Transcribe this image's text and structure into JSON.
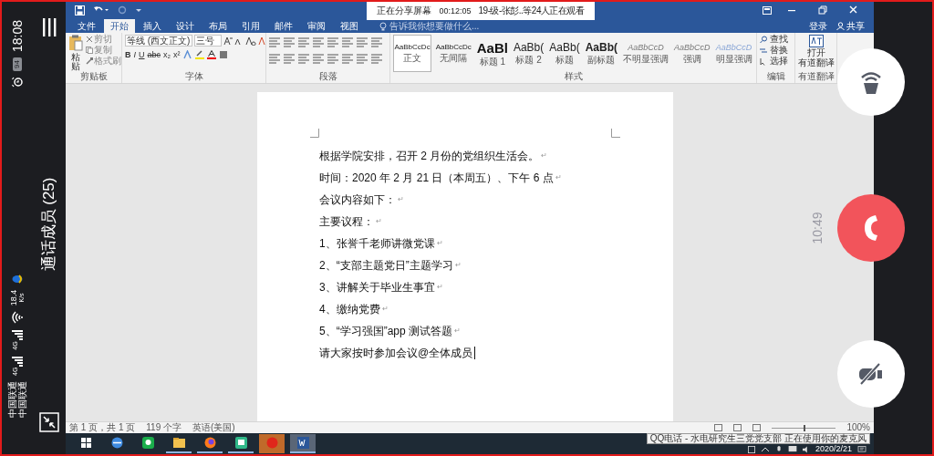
{
  "phone_status": {
    "carriers": [
      "中国联通",
      "中国联通"
    ],
    "signals": [
      {
        "network": "4G"
      },
      {
        "network": "4G"
      }
    ],
    "speed": "18.4",
    "speed_unit": "K/s",
    "battery": "94",
    "time": "18:08"
  },
  "call": {
    "title": "通话成员 (25)",
    "duration": "10:49",
    "buttons": [
      {
        "kind": "speaker"
      },
      {
        "kind": "hangup"
      },
      {
        "kind": "camera_off"
      }
    ]
  },
  "share_banner": {
    "status": "正在分享屏幕",
    "elapsed": "00:12:05",
    "viewers": "19-级-张彭..等24人正在观看"
  },
  "word": {
    "tabs": [
      {
        "label": "文件",
        "selected": false
      },
      {
        "label": "开始",
        "selected": true
      },
      {
        "label": "插入",
        "selected": false
      },
      {
        "label": "设计",
        "selected": false
      },
      {
        "label": "布局",
        "selected": false
      },
      {
        "label": "引用",
        "selected": false
      },
      {
        "label": "邮件",
        "selected": false
      },
      {
        "label": "审阅",
        "selected": false
      },
      {
        "label": "视图",
        "selected": false
      }
    ],
    "tell_me": {
      "placeholder": "告诉我你想要做什么..."
    },
    "account": {
      "sign_in": "登录",
      "share": "共享"
    },
    "clipboard": {
      "label": "剪贴板",
      "paste": "粘贴",
      "items": [
        "剪切",
        "复制",
        "格式刷"
      ]
    },
    "font": {
      "label": "字体",
      "font_name": "等线 (西文正文)",
      "font_size": "三号",
      "format_buttons": [
        "B",
        "I",
        "U",
        "abc",
        "x₂",
        "x²"
      ]
    },
    "paragraph": {
      "label": "段落"
    },
    "styles": {
      "label": "样式",
      "items": [
        {
          "kind": "body",
          "sample": "AaBbCcDc",
          "name": "正文",
          "selected": true
        },
        {
          "kind": "body",
          "sample": "AaBbCcDc",
          "name": "无间隔",
          "selected": false
        },
        {
          "kind": "heading1",
          "sample": "AaBl",
          "name": "标题 1",
          "selected": false
        },
        {
          "kind": "heading2",
          "sample": "AaBb(",
          "name": "标题 2",
          "selected": false
        },
        {
          "kind": "heading2",
          "sample": "AaBb(",
          "name": "标题",
          "selected": false
        },
        {
          "kind": "subtitle",
          "sample": "AaBb(",
          "name": "副标题",
          "selected": false
        },
        {
          "kind": "subtle",
          "sample": "AaBbCcD",
          "name": "不明显强调",
          "selected": false
        },
        {
          "kind": "subtle",
          "sample": "AaBbCcD",
          "name": "强调",
          "selected": false
        },
        {
          "kind": "intense",
          "sample": "AaBbCcD",
          "name": "明显强调",
          "selected": false
        }
      ]
    },
    "editing": {
      "label": "编辑",
      "items": [
        "查找",
        "替换",
        "选择"
      ]
    },
    "translate": {
      "label": "有道翻译",
      "button": [
        "打开",
        "有道翻译"
      ]
    },
    "document": {
      "lines": [
        {
          "text": "根据学院安排，召开 2 月份的党组织生活会。",
          "end": "↵"
        },
        {
          "text": "时间：2020 年 2 月 21 日（本周五）、下午 6 点",
          "end": "↵"
        },
        {
          "text": "会议内容如下：",
          "end": "↵"
        },
        {
          "text": "主要议程：",
          "end": "↵"
        },
        {
          "text": "1、张誉千老师讲微党课",
          "end": "↵"
        },
        {
          "text": "2、“支部主题党日”主题学习",
          "end": "↵"
        },
        {
          "text": "3、讲解关于毕业生事宜",
          "end": "↵"
        },
        {
          "text": "4、缴纳党费",
          "end": "↵"
        },
        {
          "text": "5、“学习强国”app 测试答题",
          "end": "↵"
        },
        {
          "text": "请大家按时参加会议@全体成员",
          "cursor": true
        }
      ]
    },
    "status_bar": {
      "items": [
        "第 1 页，共 1 页",
        "119 个字",
        "英语(美国)"
      ],
      "zoom_slider": {
        "level": 0.5
      },
      "zoom": "100%"
    }
  },
  "tooltip": "QQ电话 - 水电研究生三党党支部 正在使用你的麦克风",
  "taskbar": {
    "apps": [
      {
        "kind": "start",
        "open": false
      },
      {
        "kind": "browser",
        "open": false
      },
      {
        "kind": "chat",
        "open": false
      },
      {
        "kind": "files",
        "open": true
      },
      {
        "kind": "firefox",
        "open": true
      },
      {
        "kind": "editor",
        "open": true
      },
      {
        "kind": "flag",
        "open": false
      },
      {
        "kind": "word",
        "open": true
      }
    ],
    "date": "2020/2/21"
  }
}
